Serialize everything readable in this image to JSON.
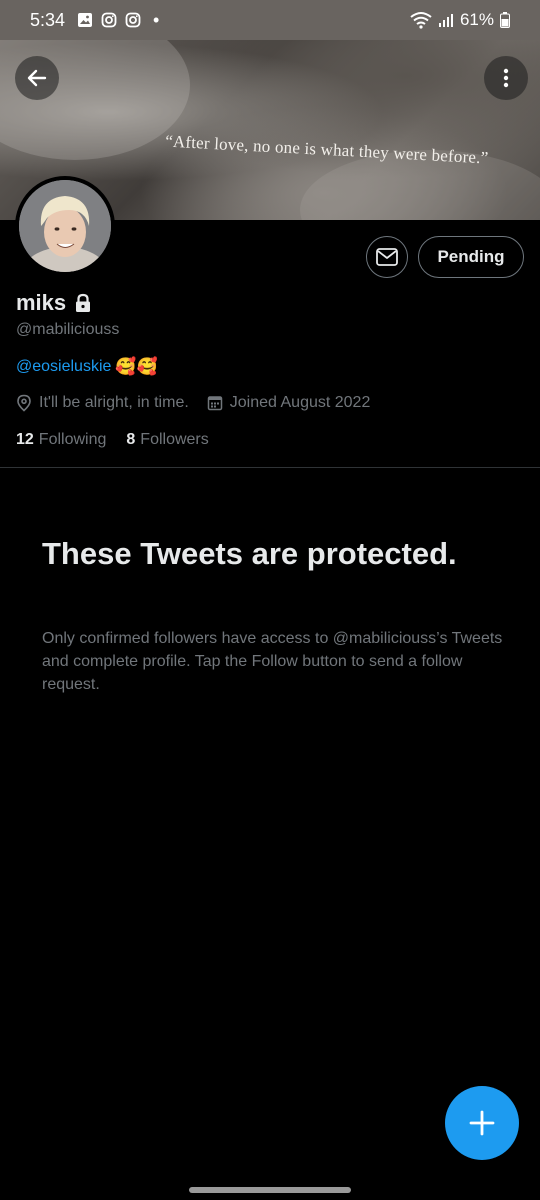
{
  "status_bar": {
    "time": "5:34",
    "battery": "61%",
    "icons": [
      "gallery-icon",
      "instagram-icon",
      "instagram-icon",
      "notification-dot",
      "wifi-icon",
      "signal-icon",
      "battery-icon"
    ]
  },
  "banner": {
    "quote": "“After love, no one is what they were before.”"
  },
  "profile": {
    "display_name": "miks",
    "handle": "@mabiliciouss",
    "bio_mention": "@eosieluskie",
    "bio_emoji": "🥰🥰",
    "location": "It'll be alright, in time.",
    "joined": "Joined August 2022",
    "following_count": "12",
    "following_label": "Following",
    "followers_count": "8",
    "followers_label": "Followers"
  },
  "actions": {
    "pending_label": "Pending"
  },
  "protected": {
    "title": "These Tweets are protected.",
    "body": "Only confirmed followers have access to @mabiliciouss’s Tweets and complete profile. Tap the Follow button to send a follow request."
  },
  "colors": {
    "accent": "#1d9bf0",
    "background": "#000000",
    "secondary_text": "#71767b",
    "status_bar": "#696460"
  }
}
